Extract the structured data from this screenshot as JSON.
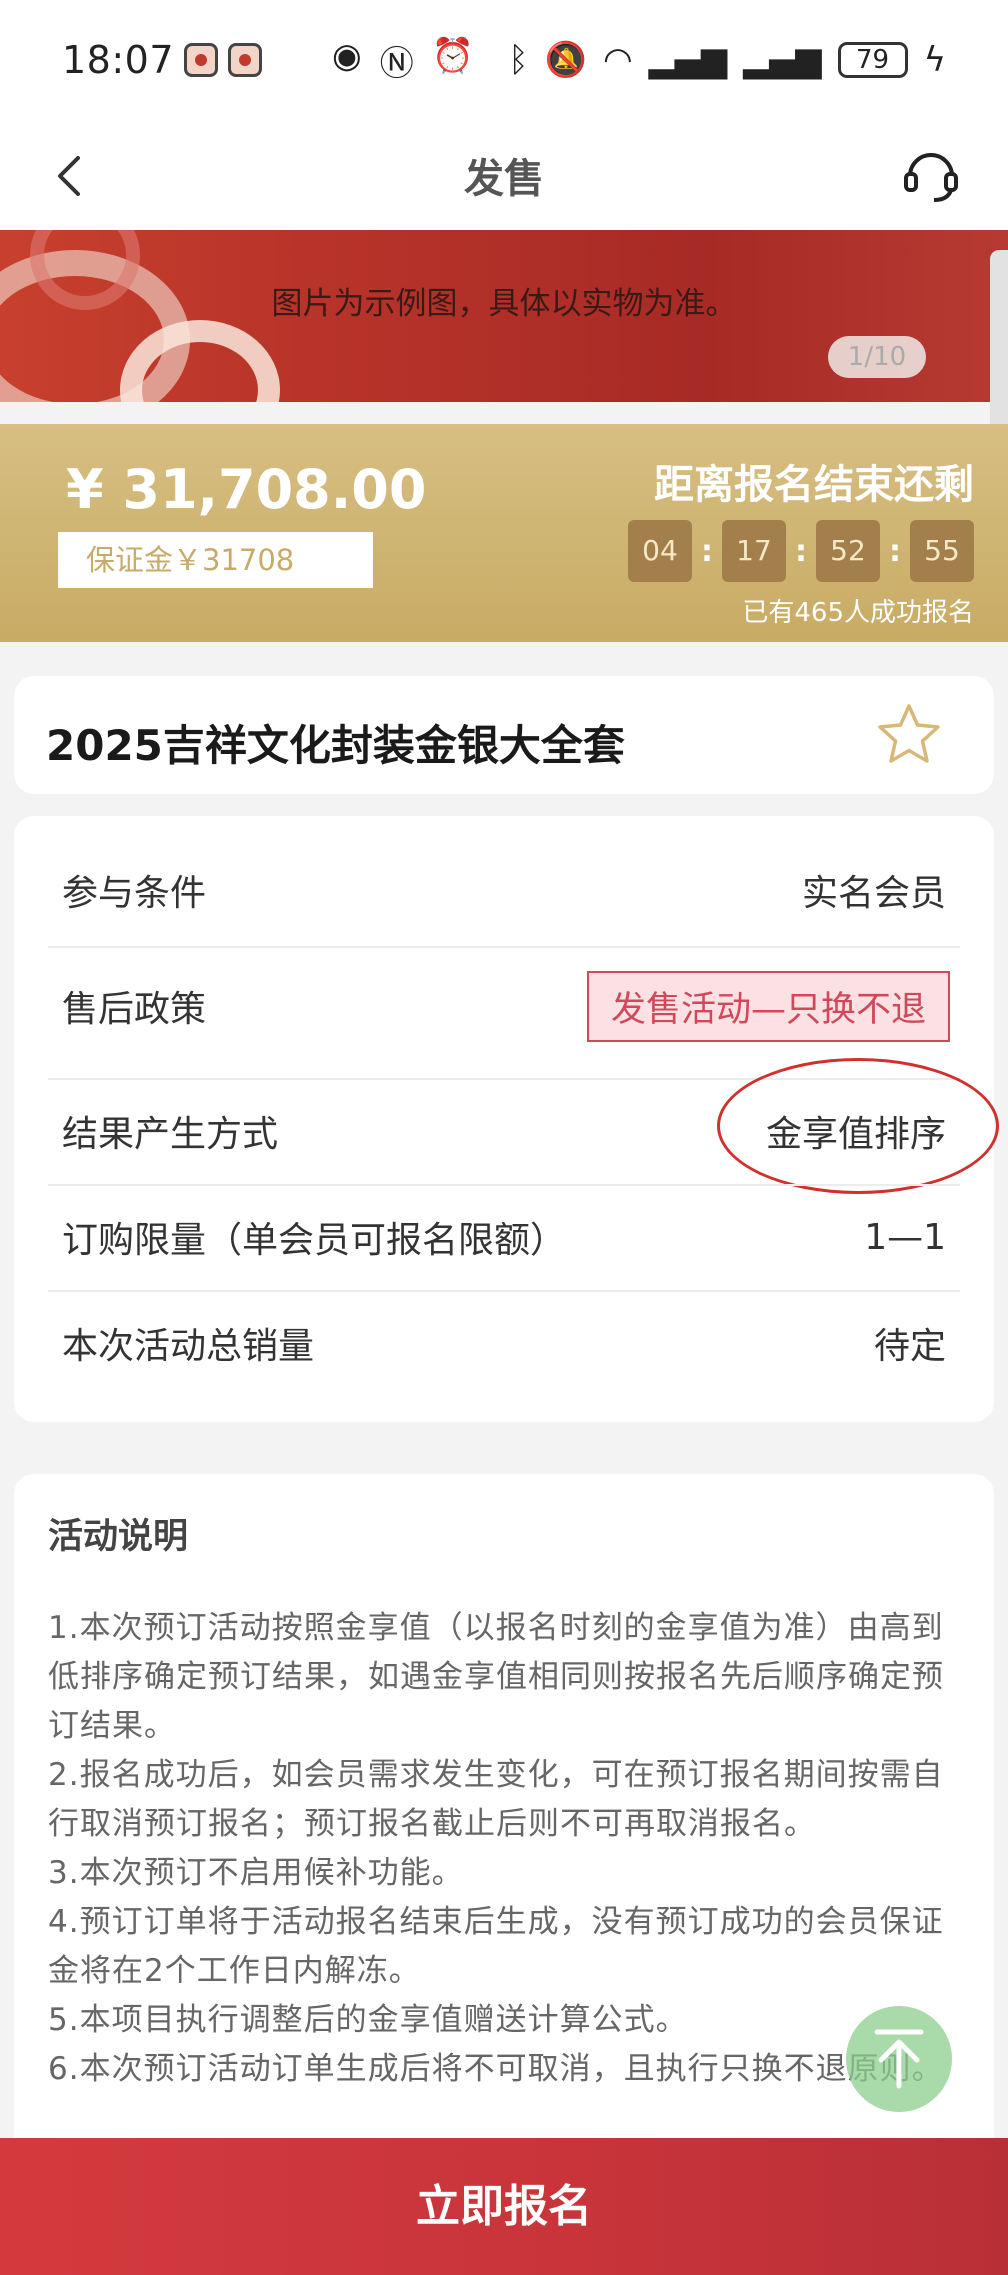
{
  "status_bar": {
    "time": "18:07",
    "battery": "79",
    "icons_left": [
      "eye-icon",
      "nfc-icon",
      "alarm-icon"
    ],
    "icons_right": [
      "bluetooth-icon",
      "mute-icon",
      "wifi-icon",
      "signal-icon",
      "4g-signal-icon",
      "charging-icon"
    ]
  },
  "nav": {
    "title": "发售",
    "back_icon": "chevron-left-icon",
    "service_icon": "headset-icon"
  },
  "banner": {
    "note": "图片为示例图，具体以实物为准。",
    "pager": "1/10"
  },
  "price_band": {
    "price": "¥ 31,708.00",
    "deposit": "保证金￥31708",
    "countdown_title": "距离报名结束还剩",
    "countdown": [
      "04",
      "17",
      "52",
      "55"
    ],
    "signed_count": "已有465人成功报名"
  },
  "product": {
    "title": "2025吉祥文化封装金银大全套",
    "favorite_icon": "star-icon"
  },
  "info": {
    "rows": [
      {
        "label": "参与条件",
        "value": "实名会员"
      },
      {
        "label": "售后政策",
        "value": "发售活动—只换不退"
      },
      {
        "label": "结果产生方式",
        "value": "金享值排序"
      },
      {
        "label": "订购限量（单会员可报名限额）",
        "value": "1—1"
      },
      {
        "label": "本次活动总销量",
        "value": "待定"
      }
    ]
  },
  "description": {
    "title": "活动说明",
    "items": [
      "1.本次预订活动按照金享值（以报名时刻的金享值为准）由高到低排序确定预订结果，如遇金享值相同则按报名先后顺序确定预订结果。",
      "2.报名成功后，如会员需求发生变化，可在预订报名期间按需自行取消预订报名；预订报名截止后则不可再取消报名。",
      "3.本次预订不启用候补功能。",
      "4.预订订单将于活动报名结束后生成，没有预订成功的会员保证金将在2个工作日内解冻。",
      "5.本项目执行调整后的金享值赠送计算公式。",
      "6.本次预订活动订单生成后将不可取消，且执行只换不退原则。"
    ]
  },
  "back_to_top_icon": "arrow-up-icon",
  "cta": {
    "label": "立即报名"
  },
  "colors": {
    "gold": "#c8ab64",
    "red": "#c7343a",
    "policy_red": "#d0495a"
  }
}
